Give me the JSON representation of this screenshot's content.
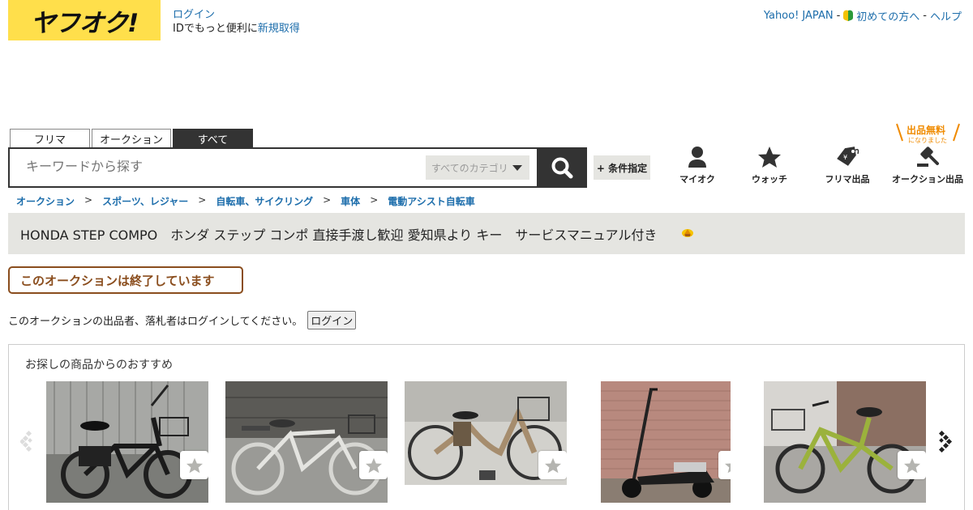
{
  "logo": {
    "text": "ヤフオク!",
    "brand_color": "#ffdf4b"
  },
  "header": {
    "login_label": "ログイン",
    "id_prompt": "IDでもっと便利に",
    "register_label": "新規取得",
    "yahoo_link": "Yahoo! JAPAN",
    "separator": "-",
    "beginners_link": "初めての方へ",
    "help_link": "ヘルプ"
  },
  "search": {
    "tabs": [
      {
        "label": "フリマ",
        "active": false
      },
      {
        "label": "オークション",
        "active": false
      },
      {
        "label": "すべて",
        "active": true
      }
    ],
    "placeholder": "キーワードから探す",
    "category_select": "すべてのカテゴリ",
    "search_icon": "search-icon",
    "condition_button": "+ 条件指定"
  },
  "nav": {
    "items": [
      {
        "label": "マイオク",
        "icon": "person-icon"
      },
      {
        "label": "ウォッチ",
        "icon": "star-icon"
      },
      {
        "label": "フリマ出品",
        "icon": "price-tag-icon"
      },
      {
        "label": "オークション出品",
        "icon": "gavel-icon"
      }
    ],
    "free_badge": {
      "line1": "出品無料",
      "line2": "になりました"
    }
  },
  "breadcrumb": {
    "items": [
      "オークション",
      "スポーツ、レジャー",
      "自転車、サイクリング",
      "車体",
      "電動アシスト自転車"
    ],
    "separator": ">"
  },
  "item": {
    "title": "HONDA STEP COMPO　ホンダ ステップ コンポ 直接手渡し歓迎 愛知県より キー　サービスマニュアル付き",
    "status": "このオークションは終了しています",
    "login_note": "このオークションの出品者、落札者はログインしてください。",
    "login_button": "ログイン"
  },
  "recommendations": {
    "title": "お探しの商品からのおすすめ",
    "items": [
      {
        "icon": "bicycle-photo",
        "watch_icon": "star-icon"
      },
      {
        "icon": "bicycle-photo",
        "watch_icon": "star-icon"
      },
      {
        "icon": "bicycle-photo",
        "watch_icon": "star-icon"
      },
      {
        "icon": "scooter-photo",
        "watch_icon": "star-icon"
      },
      {
        "icon": "bicycle-photo",
        "watch_icon": "star-icon"
      }
    ]
  },
  "colors": {
    "link": "#1c6dab",
    "dark": "#333333",
    "panel": "#e5e5e1",
    "ended": "#8a4d1d",
    "accent_orange": "#f08b00"
  }
}
